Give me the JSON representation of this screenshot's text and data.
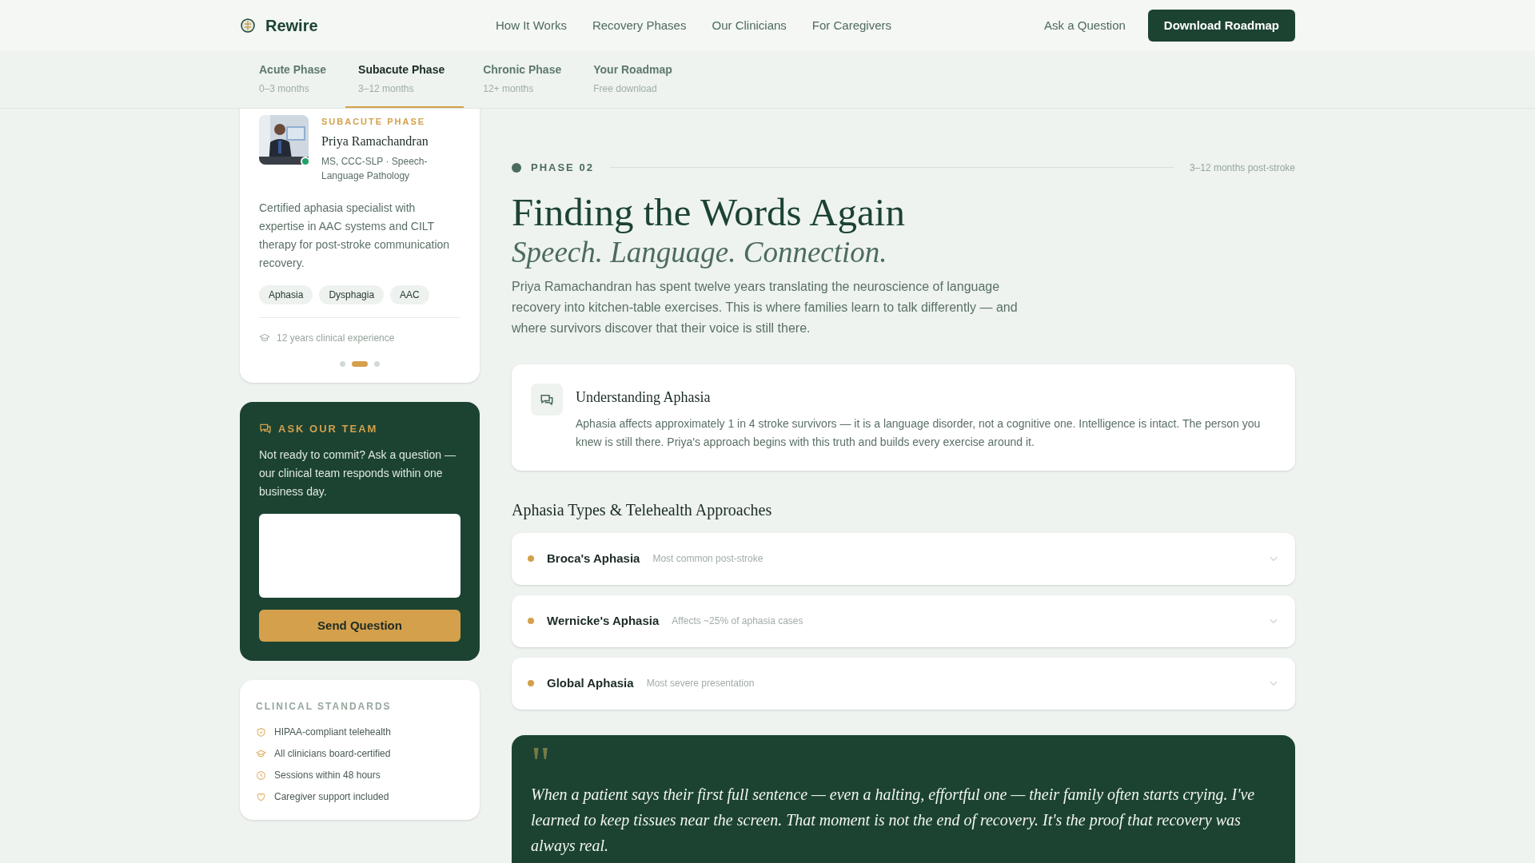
{
  "brand": {
    "name": "Rewire"
  },
  "nav": [
    "How It Works",
    "Recovery Phases",
    "Our Clinicians",
    "For Caregivers"
  ],
  "header_actions": {
    "link": "Ask a Question",
    "button": "Download Roadmap"
  },
  "phase_tabs": [
    {
      "label": "Acute Phase",
      "sub": "0–3 months",
      "selected": false
    },
    {
      "label": "Subacute Phase",
      "sub": "3–12 months",
      "selected": true
    },
    {
      "label": "Chronic Phase",
      "sub": "12+ months",
      "selected": false
    },
    {
      "label": "Your Roadmap",
      "sub": "Free download",
      "selected": false
    }
  ],
  "clinician_card": {
    "eyebrow": "SUBACUTE PHASE",
    "name": "Priya Ramachandran",
    "credentials": "MS, CCC-SLP · Speech-Language Pathology",
    "online": true,
    "bio": "Certified aphasia specialist with expertise in AAC systems and CILT therapy for post-stroke communication recovery.",
    "tags": [
      "Aphasia",
      "Dysphagia",
      "AAC"
    ],
    "experience": "12 years clinical experience",
    "carousel": [
      {
        "selected": false
      },
      {
        "selected": true
      },
      {
        "selected": false
      }
    ]
  },
  "ask_card": {
    "title": "ASK OUR TEAM",
    "text": "Not ready to commit? Ask a question — our clinical team responds within one business day.",
    "button": "Send Question"
  },
  "standards": {
    "title": "CLINICAL STANDARDS",
    "items": [
      {
        "kind": "shield",
        "label": "HIPAA-compliant telehealth"
      },
      {
        "kind": "cap",
        "label": "All clinicians board-certified"
      },
      {
        "kind": "clock",
        "label": "Sessions within 48 hours"
      },
      {
        "kind": "heart",
        "label": "Caregiver support included"
      }
    ]
  },
  "phase": {
    "label": "PHASE 02",
    "range": "3–12 months post-stroke",
    "title": "Finding the Words Again",
    "subtitle": "Speech. Language. Connection.",
    "intro": "Priya Ramachandran has spent twelve years translating the neuroscience of language recovery into kitchen-table exercises. This is where families learn to talk differently — and where survivors discover that their voice is still there."
  },
  "info_card": {
    "title": "Understanding Aphasia",
    "text": "Aphasia affects approximately 1 in 4 stroke survivors — it is a language disorder, not a cognitive one. Intelligence is intact. The person you knew is still there. Priya's approach begins with this truth and builds every exercise around it."
  },
  "types": {
    "heading": "Aphasia Types & Telehealth Approaches",
    "items": [
      {
        "title": "Broca's Aphasia",
        "note": "Most common post-stroke",
        "expanded": false
      },
      {
        "title": "Wernicke's Aphasia",
        "note": "Affects ~25% of aphasia cases",
        "expanded": false
      },
      {
        "title": "Global Aphasia",
        "note": "Most severe presentation",
        "expanded": false
      }
    ]
  },
  "quote": {
    "mark": "\"",
    "text": "When a patient says their first full sentence — even a halting, effortful one — their family often starts crying. I've learned to keep tissues near the screen. That moment is not the end of recovery. It's the proof that recovery was always real."
  }
}
